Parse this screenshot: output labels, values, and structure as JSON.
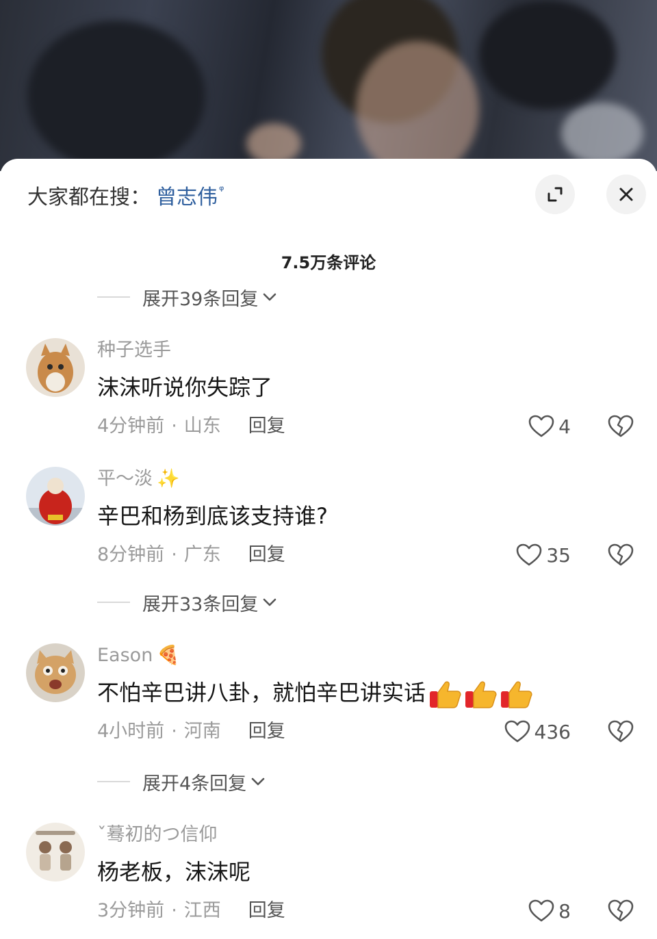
{
  "search_bar": {
    "prefix": "大家都在搜：",
    "term": "曾志伟",
    "glyph": "ᵠ"
  },
  "header_buttons": {
    "expand_icon": "expand-icon",
    "close_icon": "close-icon"
  },
  "comment_count": "7.5万条评论",
  "expand_replies": [
    {
      "label": "展开39条回复"
    },
    {
      "label": "展开33条回复"
    },
    {
      "label": "展开4条回复"
    }
  ],
  "comments": [
    {
      "username": "种子选手",
      "username_emoji": "",
      "text": "沫沫听说你失踪了",
      "time": "4分钟前",
      "location": "山东",
      "reply_label": "回复",
      "likes": "4",
      "thumbs": 0
    },
    {
      "username": "平～淡",
      "username_emoji": "✨",
      "text": "辛巴和杨到底该支持谁?",
      "time": "8分钟前",
      "location": "广东",
      "reply_label": "回复",
      "likes": "35",
      "thumbs": 0
    },
    {
      "username": "Eason",
      "username_emoji": "🍕",
      "text": "不怕辛巴讲八卦，就怕辛巴讲实话",
      "time": "4小时前",
      "location": "河南",
      "reply_label": "回复",
      "likes": "436",
      "thumbs": 3
    },
    {
      "username": "ˇ蓦初的つ信仰",
      "username_emoji": "",
      "text": "杨老板，沫沫呢",
      "time": "3分钟前",
      "location": "江西",
      "reply_label": "回复",
      "likes": "8",
      "thumbs": 0
    }
  ],
  "colors": {
    "accent_blue": "#2f5f9e",
    "secondary_text": "#9a9a9a",
    "primary_text": "#161616"
  }
}
